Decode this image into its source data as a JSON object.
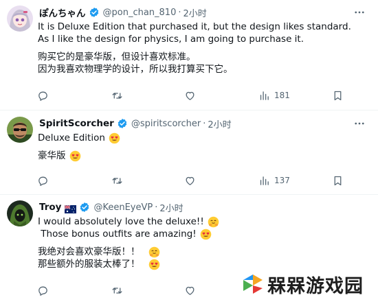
{
  "posts": [
    {
      "name": "ぽんちゃん",
      "handle": "@pon_chan_810",
      "separator": "·",
      "time": "2小时",
      "flag": false,
      "lines": [
        "It is Deluxe Edition that purchased it, but the design likes standard.",
        "As I like the design for physics, I am going to purchase it.",
        "",
        "购买它的是豪华版，但设计喜欢标准。",
        "因为我喜欢物理学的设计，所以我打算买下它。"
      ],
      "stats": {
        "replies": "",
        "reposts": "",
        "likes": "",
        "views": "181"
      }
    },
    {
      "name": "SpiritScorcher",
      "handle": "@spiritscorcher",
      "separator": "·",
      "time": "2小时",
      "flag": false,
      "lines": [
        "Deluxe Edition",
        "",
        "豪华版"
      ],
      "stats": {
        "replies": "",
        "reposts": "",
        "likes": "",
        "views": "137"
      }
    },
    {
      "name": "Troy",
      "handle": "@KeenEyeVP",
      "separator": "·",
      "time": "2小时",
      "flag": true,
      "lines": [
        "I would absolutely love the deluxe!!",
        " Those bonus outfits are amazing!",
        "",
        "我绝对会喜欢豪华版！！",
        "那些额外的服装太棒了！"
      ],
      "stats": {
        "replies": "",
        "reposts": "",
        "likes": "",
        "views": ""
      }
    }
  ],
  "watermark": {
    "text": "槑槑游戏园"
  },
  "colors": {
    "accent": "#1d9bf0",
    "muted": "#536471",
    "text": "#0f1419",
    "divider": "#eff3f4"
  }
}
